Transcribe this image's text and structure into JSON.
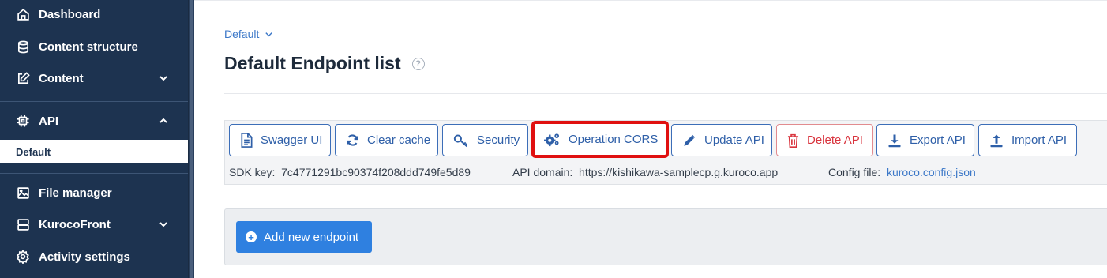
{
  "sidebar": {
    "items": [
      {
        "label": "Dashboard",
        "icon": "home-icon"
      },
      {
        "label": "Content structure",
        "icon": "database-icon"
      },
      {
        "label": "Content",
        "icon": "edit-icon"
      },
      {
        "label": "API",
        "icon": "chip-icon"
      },
      {
        "label": "Default"
      },
      {
        "label": "File manager",
        "icon": "image-icon"
      },
      {
        "label": "KurocoFront",
        "icon": "server-icon"
      },
      {
        "label": "Activity settings",
        "icon": "gear-icon"
      }
    ]
  },
  "breadcrumb": {
    "label": "Default"
  },
  "page": {
    "title": "Default Endpoint list"
  },
  "toolbar": {
    "buttons": [
      {
        "label": "Swagger UI",
        "icon": "document-icon"
      },
      {
        "label": "Clear cache",
        "icon": "refresh-icon"
      },
      {
        "label": "Security",
        "icon": "key-icon"
      },
      {
        "label": "Operation CORS",
        "icon": "gears-icon"
      },
      {
        "label": "Update API",
        "icon": "pencil-icon"
      },
      {
        "label": "Delete API",
        "icon": "trash-icon"
      },
      {
        "label": "Export API",
        "icon": "download-icon"
      },
      {
        "label": "Import API",
        "icon": "upload-icon"
      }
    ],
    "sdk_key_label": "SDK key:",
    "sdk_key_value": "7c4771291bc90374f208ddd749fe5d89",
    "api_domain_label": "API domain:",
    "api_domain_value": "https://kishikawa-samplecp.g.kuroco.app",
    "config_file_label": "Config file:",
    "config_file_value": "kuroco.config.json"
  },
  "panel": {
    "add_label": "Add new endpoint"
  },
  "colors": {
    "sidebar": "#1d3350",
    "accent": "#2f80e0",
    "danger": "#d9353f",
    "highlight": "#e01010"
  }
}
